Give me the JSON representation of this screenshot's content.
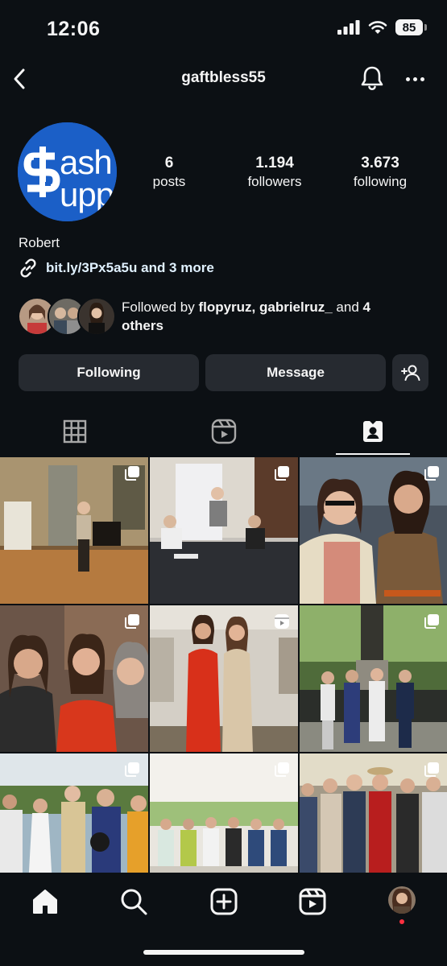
{
  "status": {
    "time": "12:06",
    "battery": "85"
  },
  "header": {
    "username": "gaftbless55"
  },
  "avatar": {
    "logo_line1": "ash",
    "logo_line2": "upp"
  },
  "stats": [
    {
      "value": "6",
      "label": "posts"
    },
    {
      "value": "1.194",
      "label": "followers"
    },
    {
      "value": "3.673",
      "label": "following"
    }
  ],
  "bio": {
    "name": "Robert",
    "link": "bit.ly/3Px5a5u and 3 more"
  },
  "mutual": {
    "prefix": "Followed by ",
    "names": "flopyruz, gabrielruz_",
    "suffix": " and ",
    "count": "4",
    "others": "others"
  },
  "actions": {
    "following_label": "Following",
    "message_label": "Message"
  },
  "tabs": [
    "grid-icon",
    "reels-icon",
    "tagged-icon"
  ],
  "active_tab": "tagged-icon",
  "grid": {
    "posts": [
      {
        "type": "image",
        "scene": "room-speaker"
      },
      {
        "type": "image",
        "scene": "panel-table"
      },
      {
        "type": "image",
        "scene": "two-women"
      },
      {
        "type": "image",
        "scene": "three-women"
      },
      {
        "type": "reel",
        "scene": "two-women-gowns"
      },
      {
        "type": "image",
        "scene": "group-statue"
      },
      {
        "type": "image",
        "scene": "group-lawn"
      },
      {
        "type": "image",
        "scene": "group-tent"
      },
      {
        "type": "image",
        "scene": "group-hall"
      }
    ]
  },
  "bottom_nav": [
    "home-icon",
    "search-icon",
    "create-icon",
    "reels-nav-icon",
    "profile-avatar"
  ],
  "colors": {
    "background": "#0c1014",
    "button": "#262a30",
    "avatar_blue": "#1b5fc7",
    "notification_dot": "#ff3040"
  }
}
